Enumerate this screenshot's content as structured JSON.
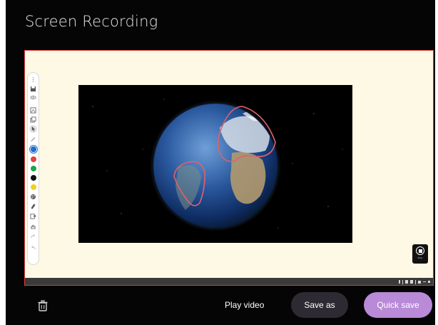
{
  "window": {
    "title": "Screen Recording"
  },
  "toolbar": {
    "tools": [
      {
        "icon": "drag-handle-icon"
      },
      {
        "icon": "save-icon"
      },
      {
        "icon": "eye-icon"
      },
      {
        "icon": "frame-icon"
      },
      {
        "icon": "copy-icon"
      },
      {
        "icon": "pointer-icon"
      },
      {
        "icon": "pen-icon"
      },
      {
        "icon": "color-blue",
        "color": "#1f6fd1"
      },
      {
        "icon": "color-red",
        "color": "#e8413a"
      },
      {
        "icon": "color-green",
        "color": "#21a348"
      },
      {
        "icon": "color-black",
        "color": "#111111"
      },
      {
        "icon": "color-yellow",
        "color": "#f1d21a"
      },
      {
        "icon": "palette-icon"
      },
      {
        "icon": "eraser-icon"
      },
      {
        "icon": "export-icon"
      },
      {
        "icon": "stamp-icon"
      },
      {
        "icon": "redo-icon"
      },
      {
        "icon": "undo-icon"
      }
    ]
  },
  "video": {
    "annotation_color": "#e0626a"
  },
  "stop_button": {
    "label": "Stop"
  },
  "footer": {
    "play_video": "Play video",
    "save_as": "Save as",
    "quick_save": "Quick save"
  },
  "colors": {
    "background": "#050505",
    "canvas": "#fdf9e4",
    "canvas_border": "#e23a3a",
    "quick_save_bg": "#b98ad7",
    "save_as_bg": "#2e2a33"
  }
}
